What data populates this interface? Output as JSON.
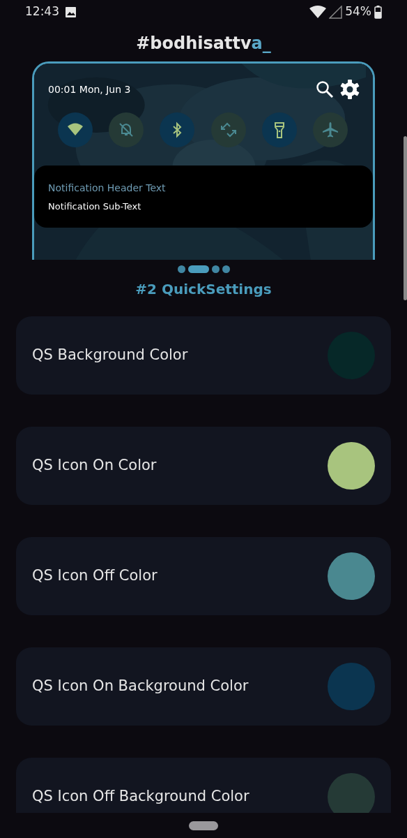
{
  "status_bar": {
    "time": "12:43",
    "battery": "54%"
  },
  "title": {
    "main": "#bodhisattv",
    "accent": "a_"
  },
  "preview": {
    "clock": "00:01 Mon, Jun 3",
    "tiles": [
      {
        "kind": "wifi",
        "on": true
      },
      {
        "kind": "dnd",
        "on": false
      },
      {
        "kind": "bluetooth",
        "on": true
      },
      {
        "kind": "rotate",
        "on": false
      },
      {
        "kind": "flashlight",
        "on": true
      },
      {
        "kind": "airplane",
        "on": false
      }
    ],
    "notification": {
      "header": "Notification Header Text",
      "sub": "Notification Sub-Text"
    }
  },
  "pager": [
    {
      "selected": false
    },
    {
      "selected": true
    },
    {
      "selected": false
    },
    {
      "selected": false
    }
  ],
  "section_title": "#2 QuickSettings",
  "settings": [
    {
      "label": "QS Background Color",
      "color": "#062828"
    },
    {
      "label": "QS Icon On Color",
      "color": "#a8c47e"
    },
    {
      "label": "QS Icon Off Color",
      "color": "#4a8890"
    },
    {
      "label": "QS Icon On Background Color",
      "color": "#0b3550"
    },
    {
      "label": "QS Icon Off Background Color",
      "color": "#253a36"
    }
  ]
}
